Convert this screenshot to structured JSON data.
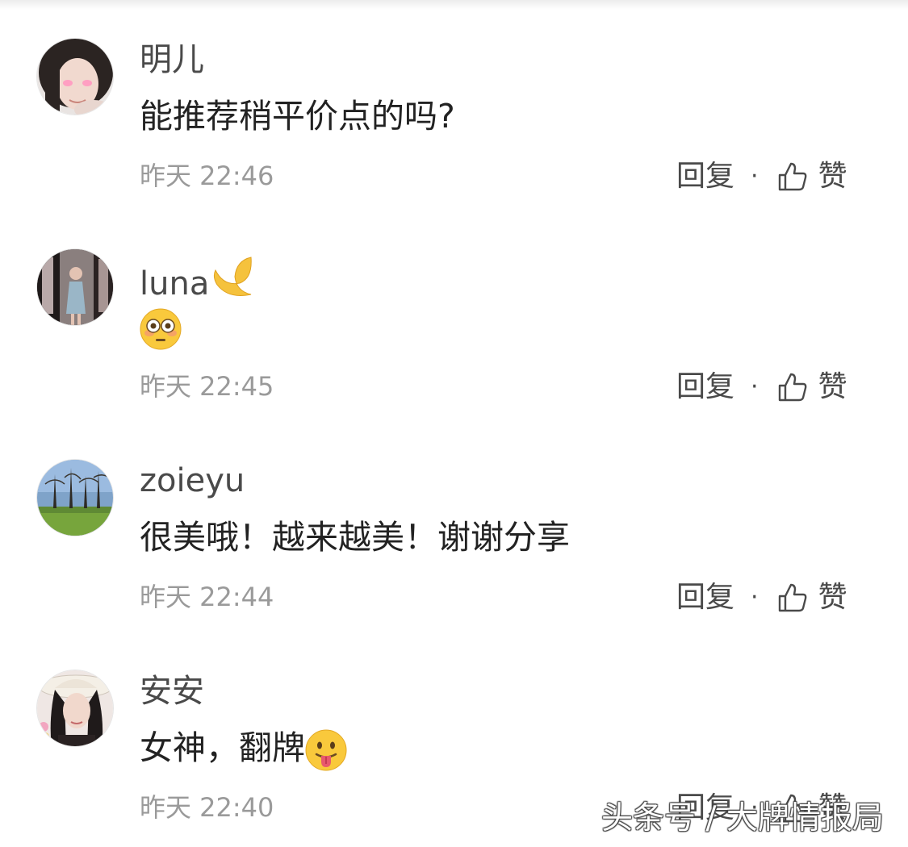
{
  "comments": [
    {
      "username": "明儿",
      "text": "能推荐稍平价点的吗?",
      "time": "昨天 22:46",
      "reply_label": "回复",
      "separator": "·",
      "like_label": "赞",
      "avatar_icon": "avatar-woman-photo"
    },
    {
      "username": "luna",
      "username_emoji": "crescent-moon-emoji",
      "text": "",
      "text_emoji": "flushed-face-emoji",
      "time": "昨天 22:45",
      "reply_label": "回复",
      "separator": "·",
      "like_label": "赞",
      "avatar_icon": "avatar-mirror-photo"
    },
    {
      "username": "zoieyu",
      "text": "很美哦！越来越美！谢谢分享",
      "time": "昨天 22:44",
      "reply_label": "回复",
      "separator": "·",
      "like_label": "赞",
      "avatar_icon": "avatar-park-photo"
    },
    {
      "username": "安安",
      "text": "女神，翻牌",
      "text_emoji": "tongue-face-emoji",
      "time": "昨天 22:40",
      "reply_label": "回复",
      "separator": "·",
      "like_label": "赞",
      "avatar_icon": "avatar-hat-photo"
    }
  ],
  "watermark": "头条号 / 大牌情报局",
  "colors": {
    "username": "#4a4a4a",
    "text": "#222222",
    "meta": "#9a9a9a",
    "background": "#ffffff"
  }
}
